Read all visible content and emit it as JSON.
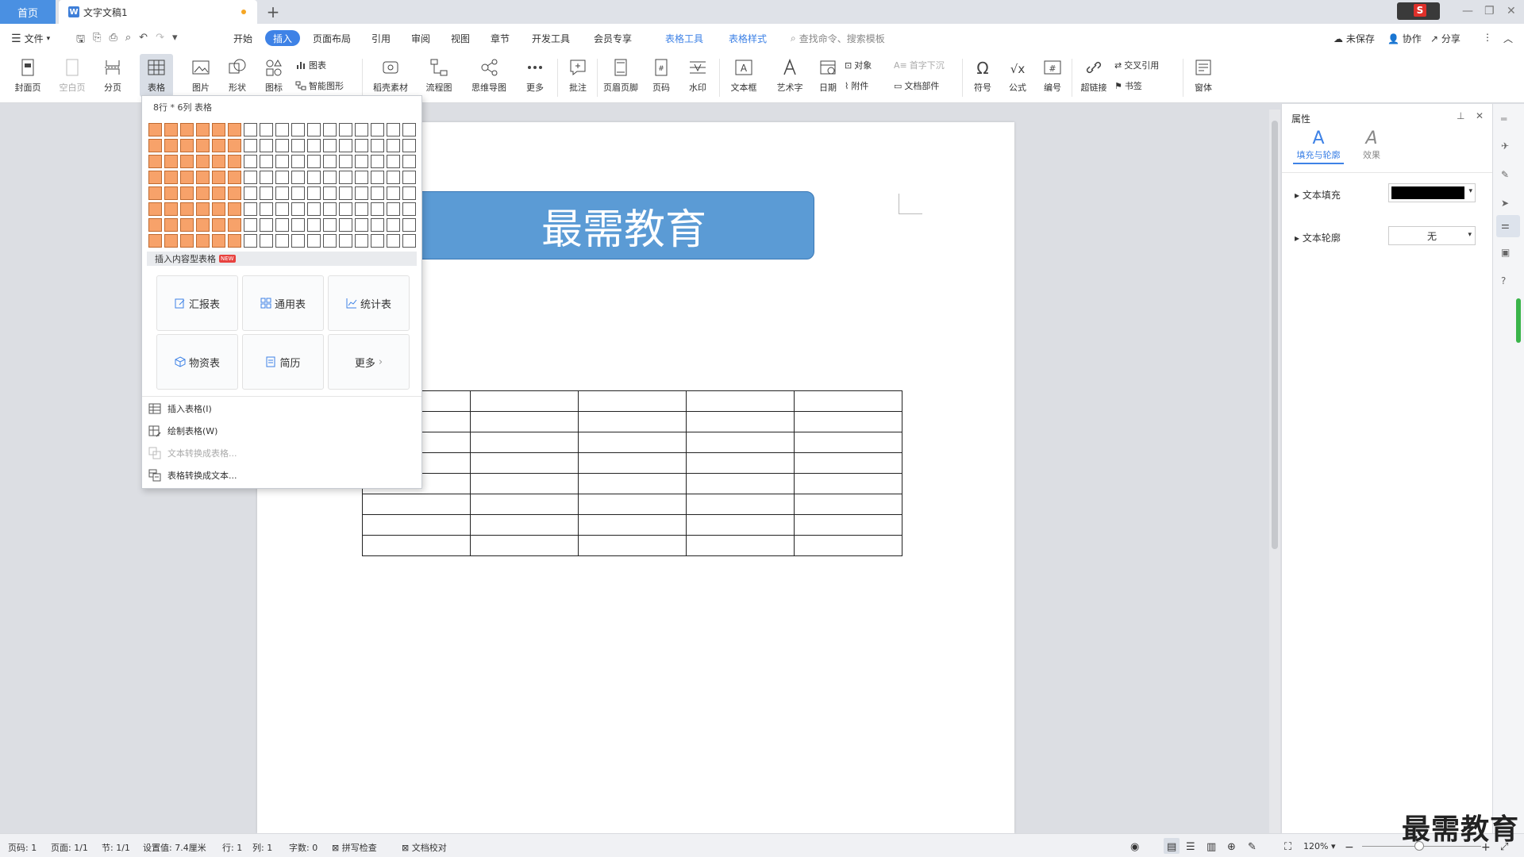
{
  "tabs": {
    "home": "首页",
    "doc": "文字文稿1",
    "add": "+"
  },
  "window": {
    "minimize": "—",
    "restore": "❐",
    "close": "✕"
  },
  "menubar": {
    "file": "文件",
    "items": [
      "开始",
      "插入",
      "页面布局",
      "引用",
      "审阅",
      "视图",
      "章节",
      "开发工具",
      "会员专享",
      "表格工具",
      "表格样式"
    ],
    "active": "插入",
    "search": "查找命令、搜索模板",
    "unsaved": "未保存",
    "collab": "协作",
    "share": "分享"
  },
  "ribbon": {
    "cover": "封面页",
    "blank": "空白页",
    "pagebreak": "分页",
    "table": "表格",
    "picture": "图片",
    "shape": "形状",
    "iconlib": "图标",
    "chart": "图表",
    "smartart": "智能图形",
    "material": "稻壳素材",
    "flowchart": "流程图",
    "mindmap": "思维导图",
    "more": "更多",
    "comment": "批注",
    "headerfooter": "页眉页脚",
    "pagenum": "页码",
    "watermark": "水印",
    "textbox": "文本框",
    "wordart": "艺术字",
    "date": "日期",
    "object": "对象",
    "attachment": "附件",
    "dropcap": "首字下沉",
    "docpart": "文档部件",
    "symbol": "符号",
    "formula": "公式",
    "numbering": "编号",
    "hyperlink": "超链接",
    "crossref": "交叉引用",
    "bookmark": "书签",
    "window": "窗体"
  },
  "dropdown": {
    "header": "8行 * 6列 表格",
    "grid": {
      "rows": 8,
      "cols": 17,
      "selected_rows": 8,
      "selected_cols": 6
    },
    "section": "插入内容型表格",
    "new_tag": "NEW",
    "cards": [
      "汇报表",
      "通用表",
      "统计表",
      "物资表",
      "简历",
      "更多"
    ],
    "items": {
      "insert": "插入表格(I)",
      "draw": "绘制表格(W)",
      "text_to_table": "文本转换成表格...",
      "table_to_text": "表格转换成文本..."
    }
  },
  "document": {
    "banner": "最需教育",
    "table": {
      "rows": 8,
      "cols": 5
    }
  },
  "panel": {
    "title": "属性",
    "tab_fill": "填充与轮廓",
    "tab_effect": "效果",
    "glyph": "A",
    "text_fill": "文本填充",
    "text_outline": "文本轮廓",
    "outline_value": "无"
  },
  "status": {
    "page": "页码: 1",
    "pages": "页面: 1/1",
    "section": "节: 1/1",
    "setting": "设置值: 7.4厘米",
    "row": "行: 1",
    "col": "列: 1",
    "words": "字数: 0",
    "spell": "拼写检查",
    "proof": "文档校对",
    "zoom": "120%"
  },
  "watermark": "最需教育",
  "colors": {
    "accent": "#3e82e6",
    "grid_selected": "#f7a26a",
    "banner": "#5b9bd5"
  }
}
